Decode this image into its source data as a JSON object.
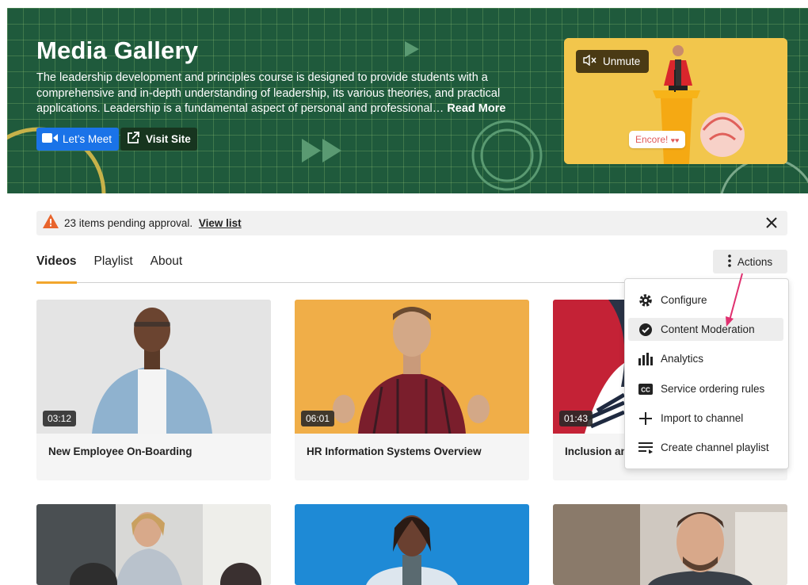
{
  "hero": {
    "title": "Media Gallery",
    "description": "The leadership development and principles course is designed to provide students with a comprehensive and in-depth understanding of leadership, its various theories, and practical applications. Leadership is a fundamental aspect of personal and professional…",
    "read_more": "Read More",
    "lets_meet_label": "Let’s Meet",
    "visit_site_label": "Visit Site",
    "unmute_label": "Unmute",
    "encore_sign": "Encore!"
  },
  "notice": {
    "text": "23 items pending approval.",
    "link": "View list"
  },
  "tabs": [
    {
      "label": "Videos",
      "active": true
    },
    {
      "label": "Playlist",
      "active": false
    },
    {
      "label": "About",
      "active": false
    }
  ],
  "actions_label": "Actions",
  "actions_menu": [
    {
      "label": "Configure",
      "icon": "gear-icon"
    },
    {
      "label": "Content Moderation",
      "icon": "check-circle-icon",
      "highlighted": true
    },
    {
      "label": "Analytics",
      "icon": "bar-chart-icon"
    },
    {
      "label": "Service ordering rules",
      "icon": "cc-icon"
    },
    {
      "label": "Import to channel",
      "icon": "plus-icon"
    },
    {
      "label": "Create channel playlist",
      "icon": "playlist-add-icon"
    }
  ],
  "videos": [
    {
      "title": "New Employee On-Boarding",
      "duration": "03:12"
    },
    {
      "title": "HR Information Systems Overview",
      "duration": "06:01"
    },
    {
      "title": "Inclusion and",
      "duration": "01:43"
    }
  ],
  "colors": {
    "hero_green": "#1f5a3c",
    "tab_underline": "#f2a62d",
    "meet_blue": "#1a73e8",
    "warning_orange": "#e8642c",
    "arrow_pink": "#e0306f"
  }
}
